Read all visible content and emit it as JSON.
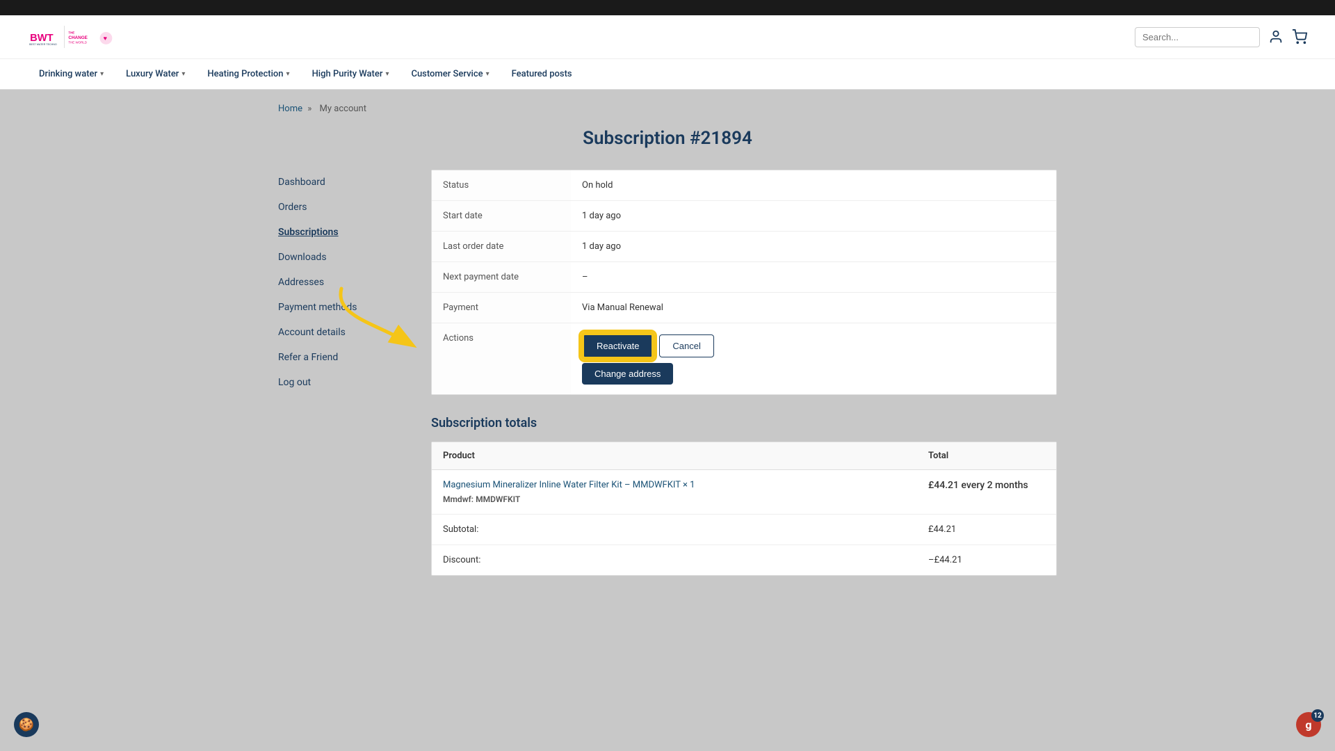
{
  "topBar": {},
  "header": {
    "logo": "BWT",
    "tagline": "CHANGE THE WORLD",
    "search": {
      "placeholder": "Search..."
    }
  },
  "nav": {
    "items": [
      {
        "label": "Drinking water",
        "hasDropdown": true
      },
      {
        "label": "Luxury Water",
        "hasDropdown": true
      },
      {
        "label": "Heating Protection",
        "hasDropdown": true
      },
      {
        "label": "High Purity Water",
        "hasDropdown": true
      },
      {
        "label": "Customer Service",
        "hasDropdown": true
      },
      {
        "label": "Featured posts",
        "hasDropdown": false
      }
    ]
  },
  "breadcrumb": {
    "home": "Home",
    "separator": "»",
    "current": "My account"
  },
  "pageTitle": "Subscription #21894",
  "sidebar": {
    "items": [
      {
        "label": "Dashboard",
        "active": false
      },
      {
        "label": "Orders",
        "active": false
      },
      {
        "label": "Subscriptions",
        "active": true
      },
      {
        "label": "Downloads",
        "active": false
      },
      {
        "label": "Addresses",
        "active": false
      },
      {
        "label": "Payment methods",
        "active": false
      },
      {
        "label": "Account details",
        "active": false
      },
      {
        "label": "Refer a Friend",
        "active": false
      },
      {
        "label": "Log out",
        "active": false
      }
    ]
  },
  "subscription": {
    "fields": [
      {
        "label": "Status",
        "value": "On hold"
      },
      {
        "label": "Start date",
        "value": "1 day ago"
      },
      {
        "label": "Last order date",
        "value": "1 day ago"
      },
      {
        "label": "Next payment date",
        "value": "–"
      },
      {
        "label": "Payment",
        "value": "Via Manual Renewal"
      }
    ],
    "actions": {
      "label": "Actions",
      "reactivate": "Reactivate",
      "cancel": "Cancel",
      "changeAddress": "Change address"
    }
  },
  "totals": {
    "title": "Subscription totals",
    "headers": {
      "product": "Product",
      "total": "Total"
    },
    "rows": [
      {
        "productName": "Magnesium Mineralizer Inline Water Filter Kit – MMDWFKIT × 1",
        "skuLabel": "Mmdwf:",
        "sku": "MMDWFKIT",
        "price": "£44.21 every 2 months"
      }
    ],
    "subtotal": {
      "label": "Subtotal:",
      "value": "£44.21"
    },
    "discount": {
      "label": "Discount:",
      "value": "–£44.21"
    }
  },
  "gorillaWidget": {
    "icon": "g",
    "badge": "12"
  }
}
